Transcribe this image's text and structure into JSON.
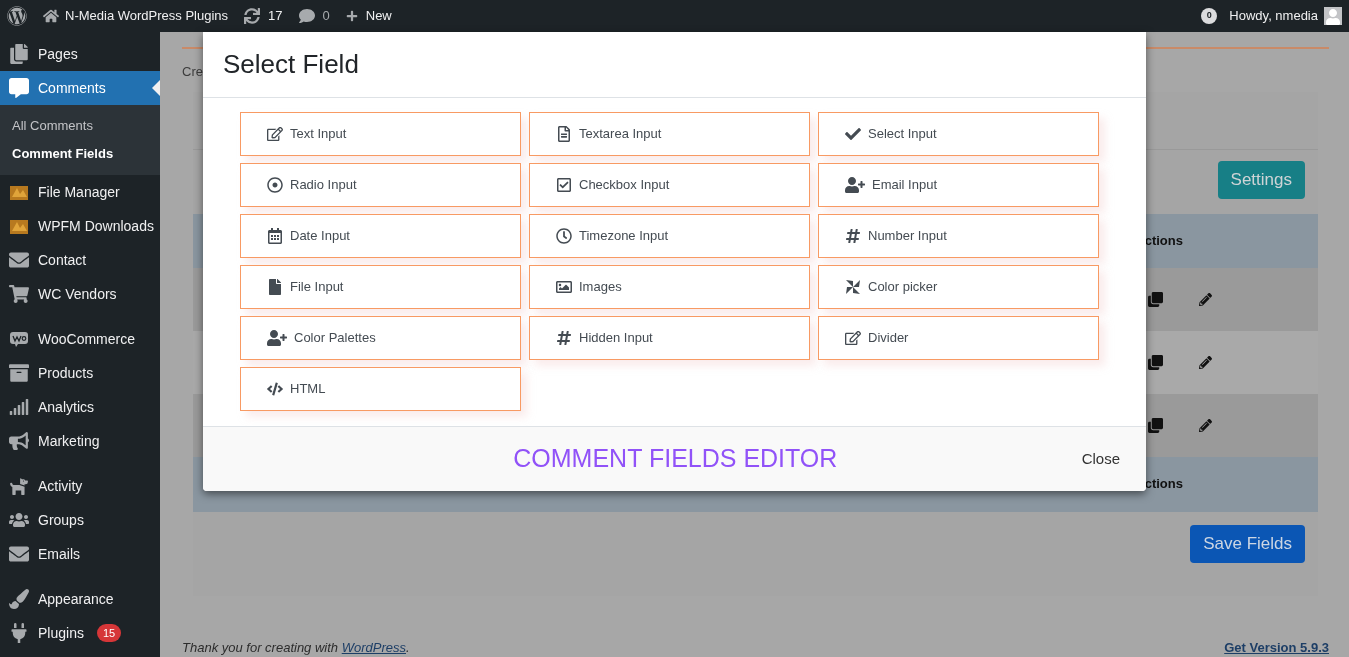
{
  "admin_bar": {
    "site": "N-Media WordPress Plugins",
    "updates": "17",
    "comments": "0",
    "new": "New",
    "notifications": "0",
    "greeting": "Howdy, nmedia"
  },
  "sidebar": {
    "groups": [
      [
        {
          "label": "Pages",
          "selected": false
        },
        {
          "label": "Comments",
          "selected": true,
          "children": [
            {
              "label": "All Comments",
              "selected": false
            },
            {
              "label": "Comment Fields",
              "selected": true
            }
          ]
        },
        {
          "label": "File Manager",
          "selected": false
        },
        {
          "label": "WPFM Downloads",
          "selected": false
        },
        {
          "label": "Contact",
          "selected": false
        },
        {
          "label": "WC Vendors",
          "selected": false
        }
      ],
      [
        {
          "label": "WooCommerce",
          "selected": false
        },
        {
          "label": "Products",
          "selected": false
        },
        {
          "label": "Analytics",
          "selected": false
        },
        {
          "label": "Marketing",
          "selected": false
        }
      ],
      [
        {
          "label": "Activity",
          "selected": false
        },
        {
          "label": "Groups",
          "selected": false
        },
        {
          "label": "Emails",
          "selected": false
        }
      ],
      [
        {
          "label": "Appearance",
          "selected": false
        },
        {
          "label": "Plugins",
          "selected": false,
          "badge": "15"
        }
      ]
    ]
  },
  "page": {
    "breadcrumb": "Cre",
    "settings_button": "Settings",
    "table": {
      "header": "ctions",
      "rows": [
        {
          "striped": true
        },
        {
          "striped": false
        },
        {
          "striped": true
        }
      ],
      "footer": "ctions"
    },
    "save_button": "Save Fields"
  },
  "footer": {
    "text": "Thank you for creating with",
    "link": "WordPress",
    "end": ".",
    "version": "Get Version 5.9.3"
  },
  "modal": {
    "title": "Select Field",
    "fields": [
      {
        "label": "Text Input"
      },
      {
        "label": "Textarea Input"
      },
      {
        "label": "Select Input"
      },
      {
        "label": "Radio Input"
      },
      {
        "label": "Checkbox Input"
      },
      {
        "label": "Email Input"
      },
      {
        "label": "Date Input"
      },
      {
        "label": "Timezone Input"
      },
      {
        "label": "Number Input"
      },
      {
        "label": "File Input"
      },
      {
        "label": "Images"
      },
      {
        "label": "Color picker"
      },
      {
        "label": "Color Palettes"
      },
      {
        "label": "Hidden Input"
      },
      {
        "label": "Divider"
      },
      {
        "label": "HTML"
      }
    ],
    "footer_title": "COMMENT FIELDS EDITOR",
    "close": "Close"
  }
}
